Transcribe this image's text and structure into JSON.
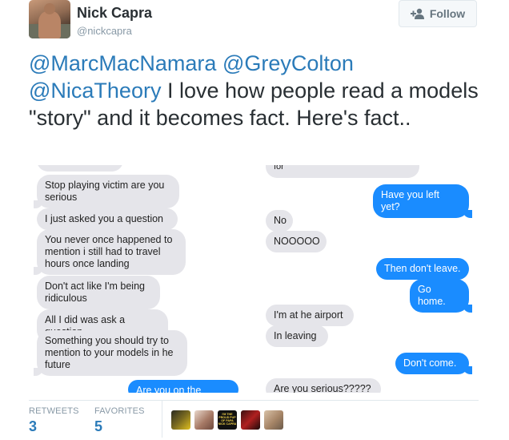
{
  "user": {
    "name": "Nick Capra",
    "handle": "@nickcapra"
  },
  "follow_button": {
    "label": "Follow",
    "icon": "add-user-icon"
  },
  "tweet": {
    "mention1": "@MarcMacNamara",
    "mention2": "@GreyColton",
    "mention3": "@NicaTheory",
    "body": " I love how people read a models \"story\" and it becomes fact. Here's fact.."
  },
  "screenshot": {
    "left_messages": [
      "Stop playing victim are you serious",
      "I just asked you a question",
      "You never once happened to mention i still had to travel hours once landing",
      "Don't act like I'm being ridiculous",
      "All I did was ask a question",
      "Something you should try to mention to your models in he future"
    ],
    "left_partial_bottom": "Are you on the plane?",
    "right_partial_top": "for",
    "right_blue_messages": [
      "Have you left yet?",
      "Then don't leave.",
      "Go home.",
      "Don't come."
    ],
    "right_gray_messages": [
      "No",
      "NOOOOO",
      "I'm at he airport",
      "In leaving",
      "Are you serious?????"
    ]
  },
  "stats": {
    "retweets_label": "RETWEETS",
    "retweets_value": "3",
    "favorites_label": "FAVORITES",
    "favorites_value": "5",
    "favorite_thumb_text": "I'M THE PROUD PUP OF PAPA NICK CAPRA"
  },
  "colors": {
    "link": "#2b7bb9",
    "imessage_blue": "#1a8cff",
    "imessage_gray": "#e5e5ea"
  }
}
